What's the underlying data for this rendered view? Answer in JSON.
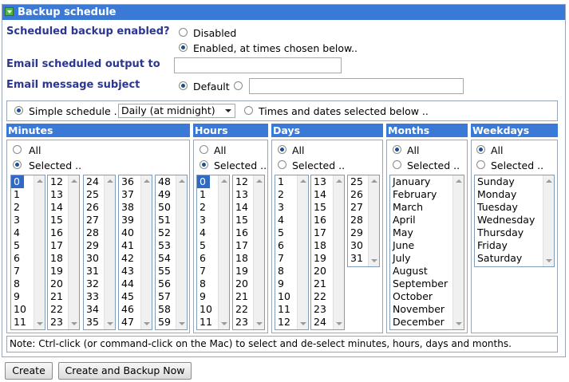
{
  "header": {
    "title": "Backup schedule"
  },
  "scheduled": {
    "label": "Scheduled backup enabled?",
    "disabled": "Disabled",
    "enabled": "Enabled, at times chosen below.."
  },
  "email": {
    "label": "Email scheduled output to",
    "value": ""
  },
  "subject": {
    "label": "Email message subject",
    "default": "Default",
    "value": ""
  },
  "schedule": {
    "simple": "Simple schedule ..",
    "simple_value": "Daily (at midnight)",
    "times": "Times and dates selected below .."
  },
  "sections": {
    "minutes": "Minutes",
    "hours": "Hours",
    "days": "Days",
    "months": "Months",
    "weekdays": "Weekdays"
  },
  "opts": {
    "all": "All",
    "selected": "Selected .."
  },
  "minutes_cols": [
    [
      "0",
      "1",
      "2",
      "3",
      "4",
      "5",
      "6",
      "7",
      "8",
      "9",
      "10",
      "11"
    ],
    [
      "12",
      "13",
      "14",
      "15",
      "16",
      "17",
      "18",
      "19",
      "20",
      "21",
      "22",
      "23"
    ],
    [
      "24",
      "25",
      "26",
      "27",
      "28",
      "29",
      "30",
      "31",
      "32",
      "33",
      "34",
      "35"
    ],
    [
      "36",
      "37",
      "38",
      "39",
      "40",
      "41",
      "42",
      "43",
      "44",
      "45",
      "46",
      "47"
    ],
    [
      "48",
      "49",
      "50",
      "51",
      "52",
      "53",
      "54",
      "55",
      "56",
      "57",
      "58",
      "59"
    ]
  ],
  "hours_cols": [
    [
      "0",
      "1",
      "2",
      "3",
      "4",
      "5",
      "6",
      "7",
      "8",
      "9",
      "10",
      "11"
    ],
    [
      "12",
      "13",
      "14",
      "15",
      "16",
      "17",
      "18",
      "19",
      "20",
      "21",
      "22",
      "23"
    ]
  ],
  "days_cols": [
    [
      "1",
      "2",
      "3",
      "4",
      "5",
      "6",
      "7",
      "8",
      "9",
      "10",
      "11",
      "12"
    ],
    [
      "13",
      "14",
      "15",
      "16",
      "17",
      "18",
      "19",
      "20",
      "21",
      "22",
      "23",
      "24"
    ],
    [
      "25",
      "26",
      "27",
      "28",
      "29",
      "30",
      "31"
    ]
  ],
  "months": [
    "January",
    "February",
    "March",
    "April",
    "May",
    "June",
    "July",
    "August",
    "September",
    "October",
    "November",
    "December"
  ],
  "weekdays": [
    "Sunday",
    "Monday",
    "Tuesday",
    "Wednesday",
    "Thursday",
    "Friday",
    "Saturday"
  ],
  "note": "Note: Ctrl-click (or command-click on the Mac) to select and de-select minutes, hours, days and months.",
  "buttons": {
    "create": "Create",
    "create_backup": "Create and Backup Now"
  }
}
